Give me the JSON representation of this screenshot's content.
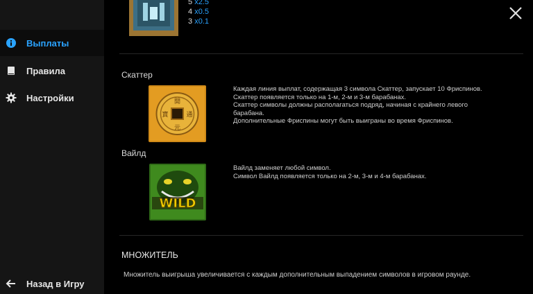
{
  "sidebar": {
    "items": [
      {
        "label": "Выплаты",
        "icon": "info-icon",
        "active": true
      },
      {
        "label": "Правила",
        "icon": "book-icon",
        "active": false
      },
      {
        "label": "Настройки",
        "icon": "gear-icon",
        "active": false
      }
    ],
    "back_label": "Назад в Игру"
  },
  "paytable_top": {
    "rows": [
      {
        "count": "5",
        "mult": "x2.5"
      },
      {
        "count": "4",
        "mult": "x0.5"
      },
      {
        "count": "3",
        "mult": "x0.1"
      }
    ]
  },
  "scatter": {
    "title": "Скаттер",
    "lines": [
      "Каждая линия выплат, содержащая 3 символа Скаттер, запускает 10 Фриспинов.",
      "Скаттер появляется только на 1-м, 2-м и 3-м барабанах.",
      "Скаттер символы должны располагаться подряд, начиная с крайнего левого",
      "барабана.",
      "Дополнительные Фриспины могут быть выиграны во время Фриспинов."
    ]
  },
  "wild": {
    "title": "Вайлд",
    "symbol_text": "WILD",
    "lines": [
      "Вайлд заменяет любой символ.",
      "Символ Вайлд появляется только на 2-м, 3-м и 4-м барабанах."
    ]
  },
  "multiplier": {
    "title": "МНОЖИТЕЛЬ",
    "text": "Множитель выигрыша увеличивается с каждым дополнительным выпадением символов в игровом раунде."
  },
  "colors": {
    "accent": "#2aa3ff",
    "sidebar_bg": "#151515",
    "bg": "#000000"
  }
}
